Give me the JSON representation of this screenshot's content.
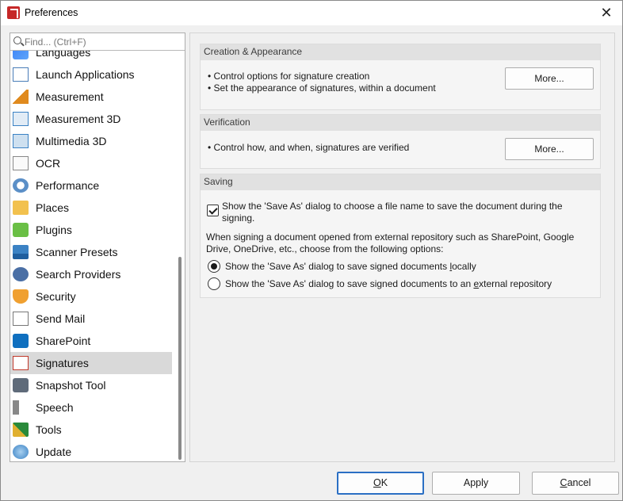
{
  "window": {
    "title": "Preferences"
  },
  "search": {
    "placeholder": "Find... (Ctrl+F)"
  },
  "sidebar": {
    "items": [
      {
        "label": "Languages",
        "icon": "languages-icon"
      },
      {
        "label": "Launch Applications",
        "icon": "launch-applications-icon"
      },
      {
        "label": "Measurement",
        "icon": "ruler-icon"
      },
      {
        "label": "Measurement 3D",
        "icon": "cube-measure-icon"
      },
      {
        "label": "Multimedia 3D",
        "icon": "cube-icon"
      },
      {
        "label": "OCR",
        "icon": "ocr-icon"
      },
      {
        "label": "Performance",
        "icon": "gauge-icon"
      },
      {
        "label": "Places",
        "icon": "folder-pin-icon"
      },
      {
        "label": "Plugins",
        "icon": "puzzle-icon"
      },
      {
        "label": "Scanner Presets",
        "icon": "scanner-icon"
      },
      {
        "label": "Search Providers",
        "icon": "binoculars-icon"
      },
      {
        "label": "Security",
        "icon": "shield-icon"
      },
      {
        "label": "Send Mail",
        "icon": "mail-icon"
      },
      {
        "label": "SharePoint",
        "icon": "sharepoint-icon"
      },
      {
        "label": "Signatures",
        "icon": "signature-icon",
        "selected": true
      },
      {
        "label": "Snapshot Tool",
        "icon": "camera-icon"
      },
      {
        "label": "Speech",
        "icon": "speaker-icon"
      },
      {
        "label": "Tools",
        "icon": "tools-icon"
      },
      {
        "label": "Update",
        "icon": "globe-icon"
      }
    ]
  },
  "creation": {
    "header": "Creation & Appearance",
    "bullet1": "• Control options for signature creation",
    "bullet2": "• Set the appearance of signatures, within a document",
    "button": "More..."
  },
  "verification": {
    "header": "Verification",
    "bullet1": "• Control how, and when, signatures are verified",
    "button": "More..."
  },
  "saving": {
    "header": "Saving",
    "checkbox_label_line1": "Show the 'Save As' dialog to choose a file name to save the document during the",
    "checkbox_label_line2": "signing.",
    "checkbox_checked": true,
    "para_line1": "When signing a document opened from external repository such as SharePoint, Google",
    "para_line2": "Drive, OneDrive, etc., choose from the following options:",
    "radio1_pre": "Show the 'Save As' dialog to save signed documents ",
    "radio1_ul": "l",
    "radio1_post": "ocally",
    "radio2_pre": "Show the 'Save As' dialog to save signed documents to an ",
    "radio2_ul": "e",
    "radio2_post": "xternal repository",
    "selected_option": 1
  },
  "footer": {
    "ok_ul": "O",
    "ok_rest": "K",
    "apply": "Apply",
    "cancel_ul": "C",
    "cancel_rest": "ancel"
  },
  "colors": {
    "default_button_border": "#2b6fc4",
    "selected_item_bg": "#d9d9d9",
    "app_icon": "#c62828"
  }
}
